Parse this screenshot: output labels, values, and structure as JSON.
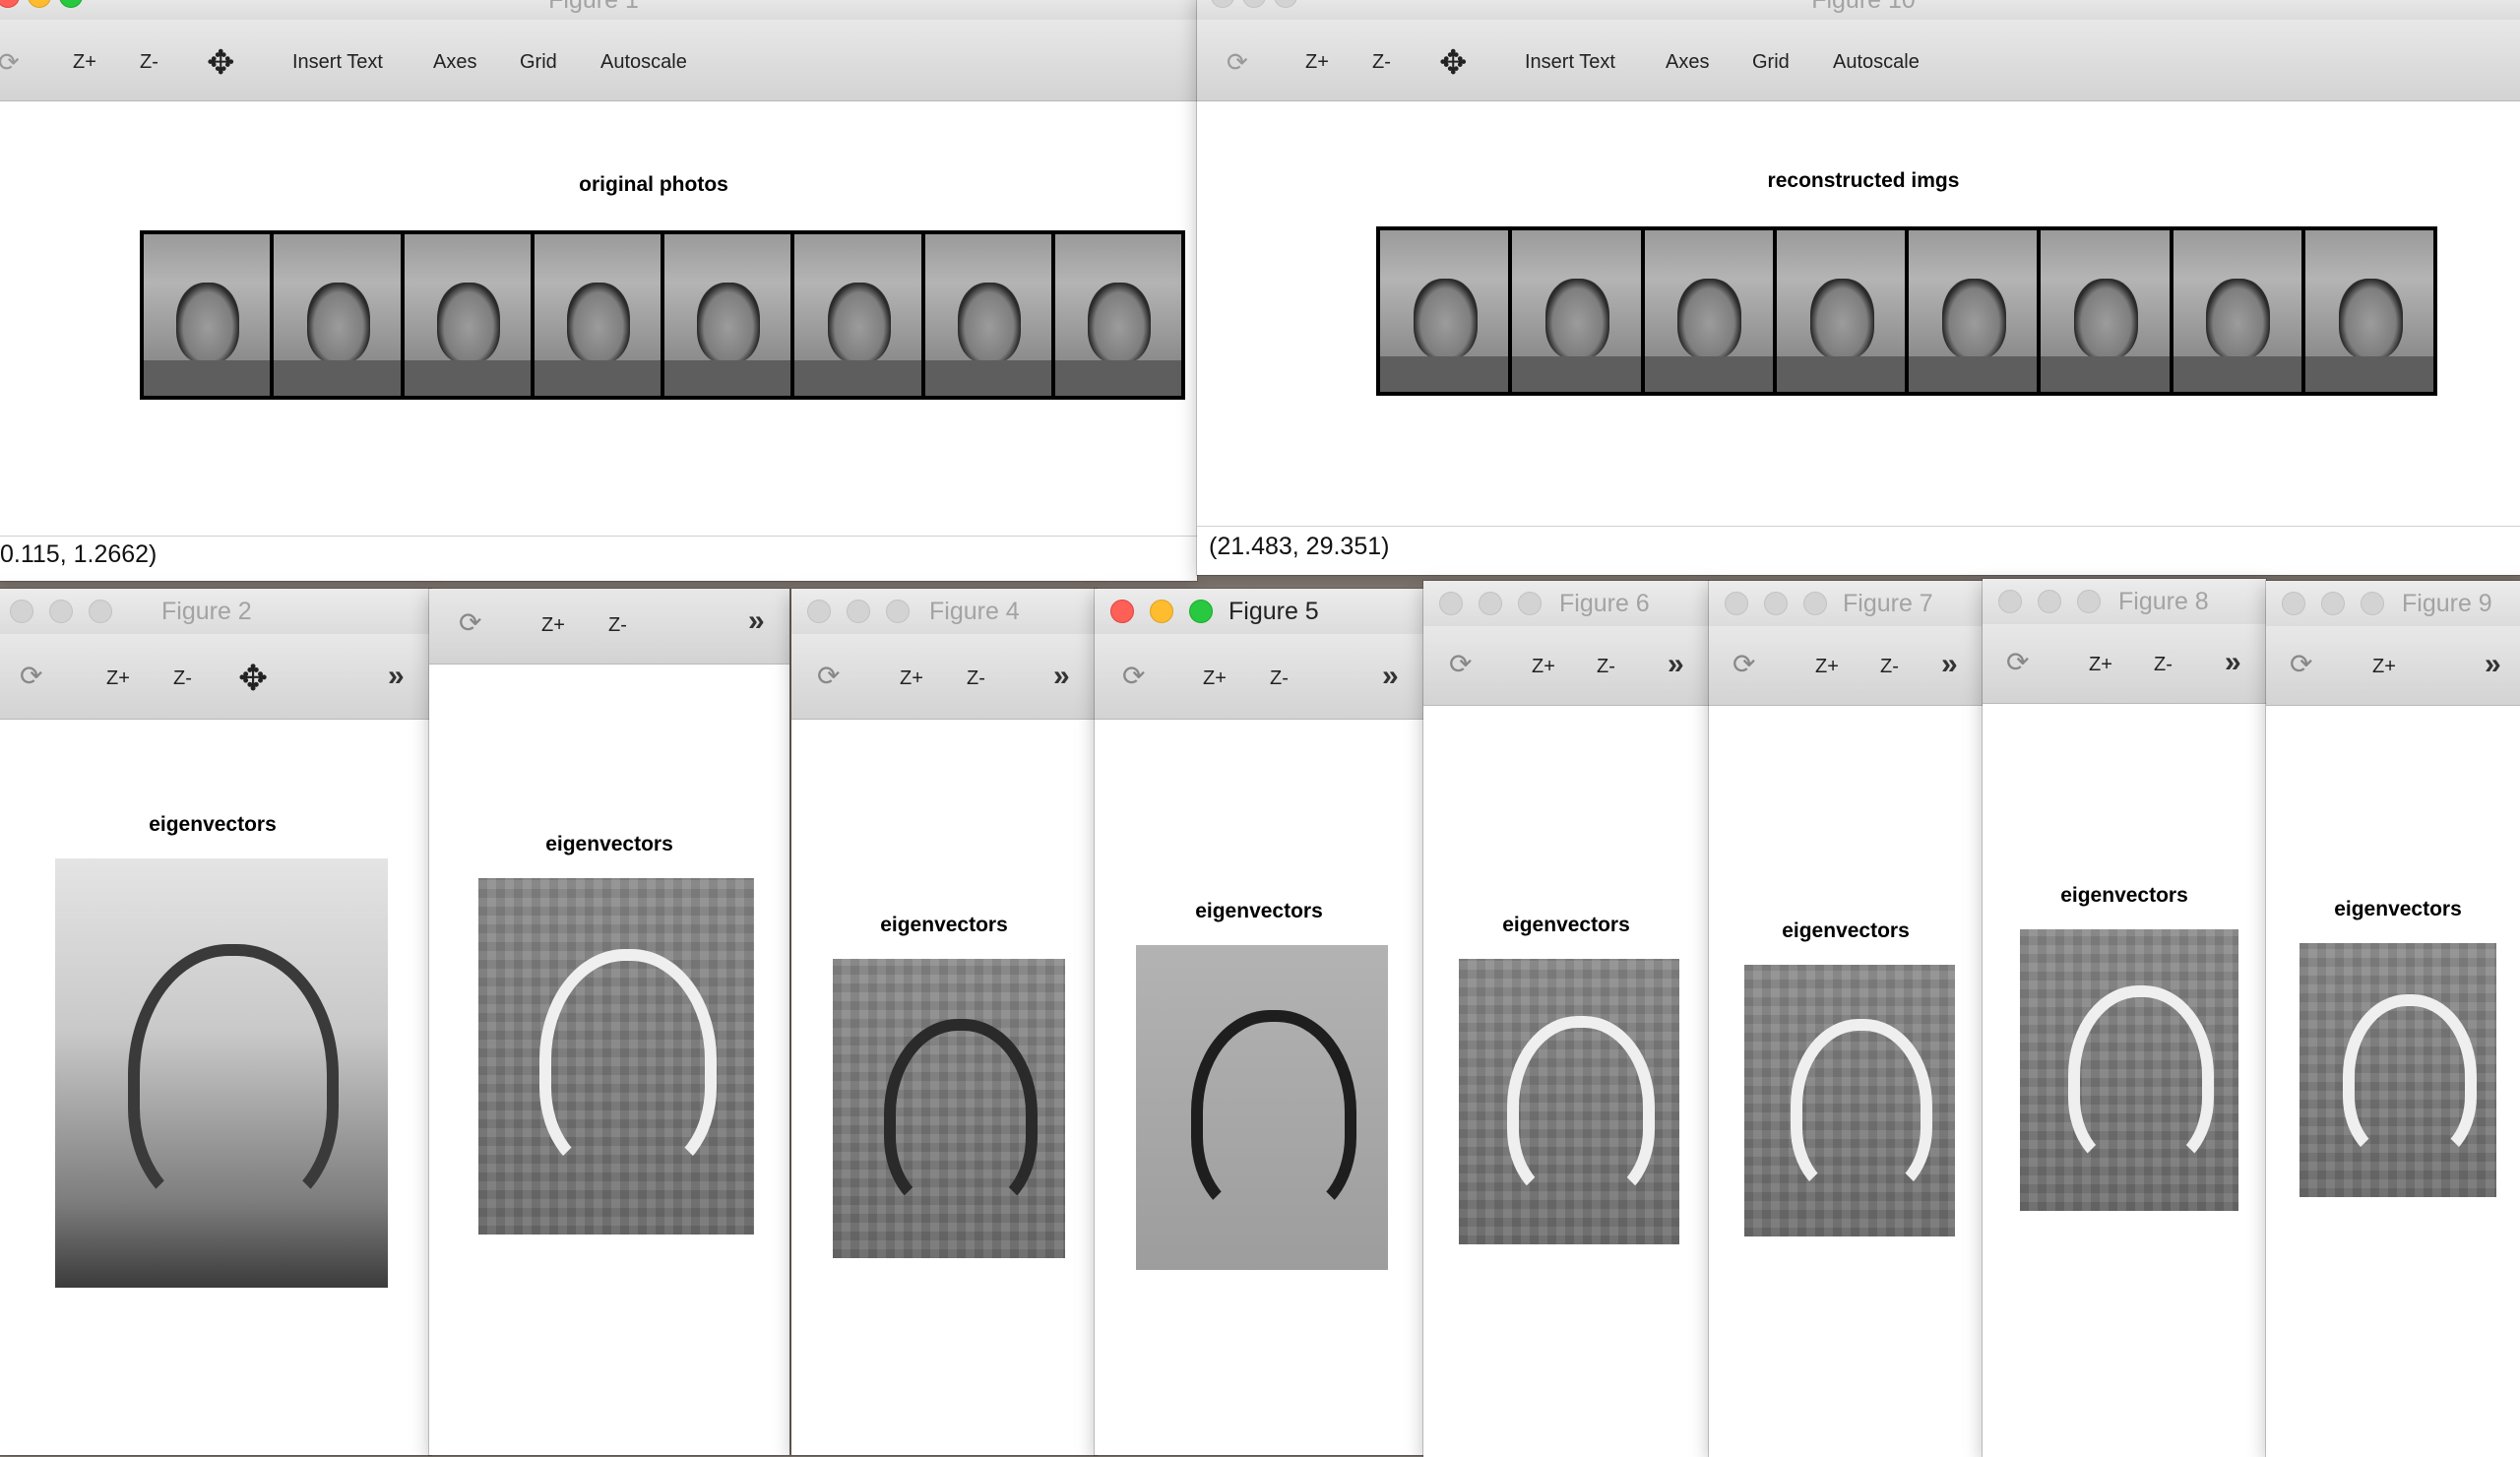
{
  "toolbar_labels": {
    "zoom_in": "Z+",
    "zoom_out": "Z-",
    "insert_text": "Insert Text",
    "axes": "Axes",
    "grid": "Grid",
    "autoscale": "Autoscale",
    "more": "»"
  },
  "figure1": {
    "window_title": "Figure 1",
    "plot_title": "original photos",
    "status": "0.115, 1.2662)"
  },
  "figure10": {
    "window_title": "Figure 10",
    "plot_title": "reconstructed imgs",
    "status": "(21.483, 29.351)"
  },
  "eigen_windows": [
    {
      "window_title": "Figure 2",
      "plot_title": "eigenvectors"
    },
    {
      "window_title": "",
      "plot_title": "eigenvectors"
    },
    {
      "window_title": "Figure 4",
      "plot_title": "eigenvectors"
    },
    {
      "window_title": "Figure 5",
      "plot_title": "eigenvectors"
    },
    {
      "window_title": "Figure 6",
      "plot_title": "eigenvectors"
    },
    {
      "window_title": "Figure 7",
      "plot_title": "eigenvectors"
    },
    {
      "window_title": "Figure 8",
      "plot_title": "eigenvectors"
    },
    {
      "window_title": "Figure 9",
      "plot_title": "eigenvectors"
    }
  ],
  "icons": {
    "reset": "reset-view-icon",
    "pan": "pan-arrows-icon",
    "more": "chevron-double-right-icon"
  },
  "colors": {
    "close": "#fe5f57",
    "minimize": "#febc2e",
    "zoom": "#28c840"
  }
}
